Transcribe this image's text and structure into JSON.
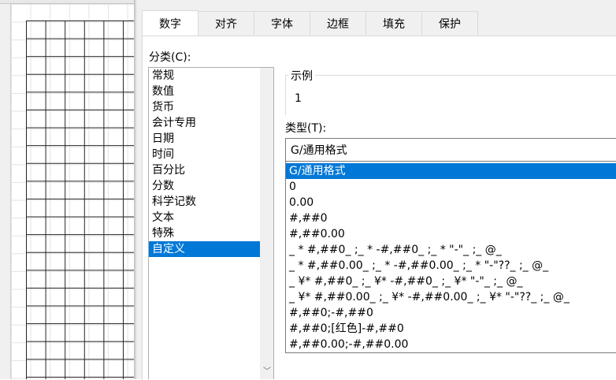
{
  "dialog": {
    "tabs": [
      {
        "label": "数字",
        "active": true
      },
      {
        "label": "对齐",
        "active": false
      },
      {
        "label": "字体",
        "active": false
      },
      {
        "label": "边框",
        "active": false
      },
      {
        "label": "填充",
        "active": false
      },
      {
        "label": "保护",
        "active": false
      }
    ],
    "category_label": "分类(C):",
    "categories": [
      {
        "label": "常规",
        "selected": false
      },
      {
        "label": "数值",
        "selected": false
      },
      {
        "label": "货币",
        "selected": false
      },
      {
        "label": "会计专用",
        "selected": false
      },
      {
        "label": "日期",
        "selected": false
      },
      {
        "label": "时间",
        "selected": false
      },
      {
        "label": "百分比",
        "selected": false
      },
      {
        "label": "分数",
        "selected": false
      },
      {
        "label": "科学记数",
        "selected": false
      },
      {
        "label": "文本",
        "selected": false
      },
      {
        "label": "特殊",
        "selected": false
      },
      {
        "label": "自定义",
        "selected": true
      }
    ],
    "sample": {
      "legend": "示例",
      "value": "1"
    },
    "type_label": "类型(T):",
    "type_value": "G/通用格式",
    "formats": [
      {
        "label": "G/通用格式",
        "selected": true
      },
      {
        "label": "0",
        "selected": false
      },
      {
        "label": "0.00",
        "selected": false
      },
      {
        "label": "#,##0",
        "selected": false
      },
      {
        "label": "#,##0.00",
        "selected": false
      },
      {
        "label": "_ * #,##0_ ;_ * -#,##0_ ;_ * \"-\"_ ;_ @_",
        "selected": false
      },
      {
        "label": "_ * #,##0.00_ ;_ * -#,##0.00_ ;_ * \"-\"??_ ;_ @_",
        "selected": false
      },
      {
        "label": "_ ¥* #,##0_ ;_ ¥* -#,##0_ ;_ ¥* \"-\"_ ;_ @_",
        "selected": false
      },
      {
        "label": "_ ¥* #,##0.00_ ;_ ¥* -#,##0.00_ ;_ ¥* \"-\"??_ ;_ @_",
        "selected": false
      },
      {
        "label": "#,##0;-#,##0",
        "selected": false
      },
      {
        "label": "#,##0;[红色]-#,##0",
        "selected": false
      },
      {
        "label": "#,##0.00;-#,##0.00",
        "selected": false
      }
    ],
    "colors": {
      "selection": "#0078d7",
      "dialog_bg": "#f0f0f0"
    }
  }
}
